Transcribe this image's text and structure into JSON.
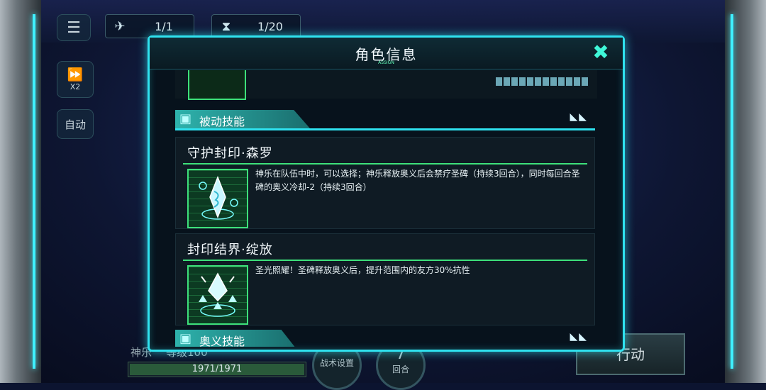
{
  "hud": {
    "menu_icon": "hamburger-menu-icon",
    "counter1": {
      "icon": "unit-icon",
      "value": "1/1"
    },
    "counter2": {
      "icon": "hourglass-icon",
      "value": "1/20"
    },
    "speed_label": "X2",
    "auto_label": "自动",
    "char_name": "神乐",
    "char_level": "等级100",
    "hp": "1971/1971",
    "hp_fraction": 1.0,
    "tactics_label": "战术设置",
    "round_label": "回合",
    "round_value": "7",
    "action_label": "行动"
  },
  "modal": {
    "title": "角色信息",
    "subtitle_tiny": "ASSIGN",
    "section_passive": "被动技能",
    "section_ultimate": "奥义技能",
    "skills": [
      {
        "name": "守护封印·森罗",
        "icon": "crystal-seal-icon",
        "desc": "神乐在队伍中时，可以选择；神乐释放奥义后会禁疗圣碑（持续3回合），同时每回合圣碑的奥义冷却-2（持续3回合）"
      },
      {
        "name": "封印结界·绽放",
        "icon": "crystal-barrier-icon",
        "desc": "圣光照耀！圣碑释放奥义后，提升范围内的友方30%抗性"
      }
    ]
  },
  "colors": {
    "accent": "#2fe2ef",
    "green": "#3de07a",
    "bg": "#07121c"
  }
}
